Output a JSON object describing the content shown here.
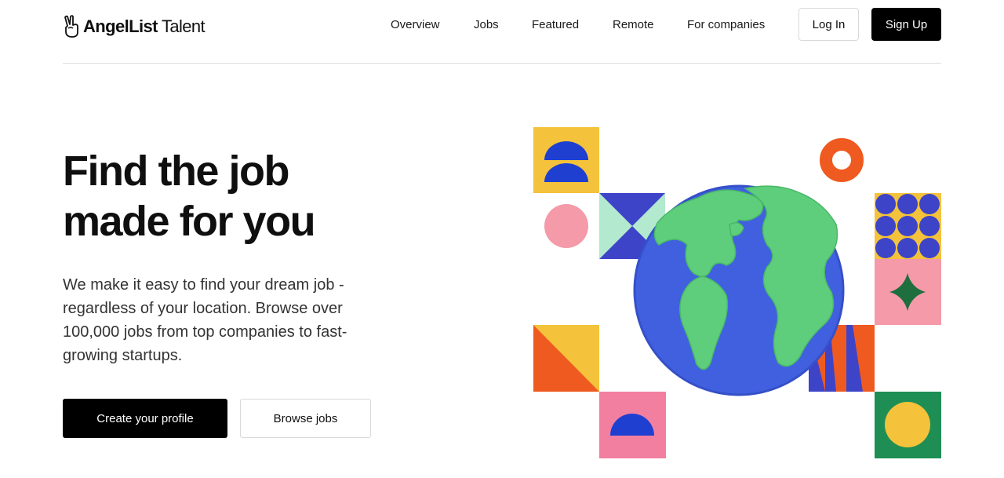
{
  "header": {
    "brand_bold": "AngelList",
    "brand_light": "Talent",
    "nav": [
      "Overview",
      "Jobs",
      "Featured",
      "Remote",
      "For companies"
    ],
    "login_label": "Log In",
    "signup_label": "Sign Up"
  },
  "hero": {
    "title_line1": "Find the job",
    "title_line2": "made for you",
    "subtitle": "We make it easy to find your dream job - regardless of your location. Browse over 100,000 jobs from top companies to fast-growing startups.",
    "primary_cta": "Create your profile",
    "secondary_cta": "Browse jobs"
  },
  "colors": {
    "yellow": "#f4c23b",
    "blue": "#1f3fd1",
    "purple_blue": "#3e44c8",
    "mint": "#b2e9cf",
    "pink": "#f49aa8",
    "orange": "#ef5a20",
    "green": "#1e8e55",
    "hot_pink": "#f27fa0",
    "globe_blue": "#4060e0",
    "land_green": "#5fce7c"
  },
  "icons": [
    "peace-hand-icon"
  ]
}
